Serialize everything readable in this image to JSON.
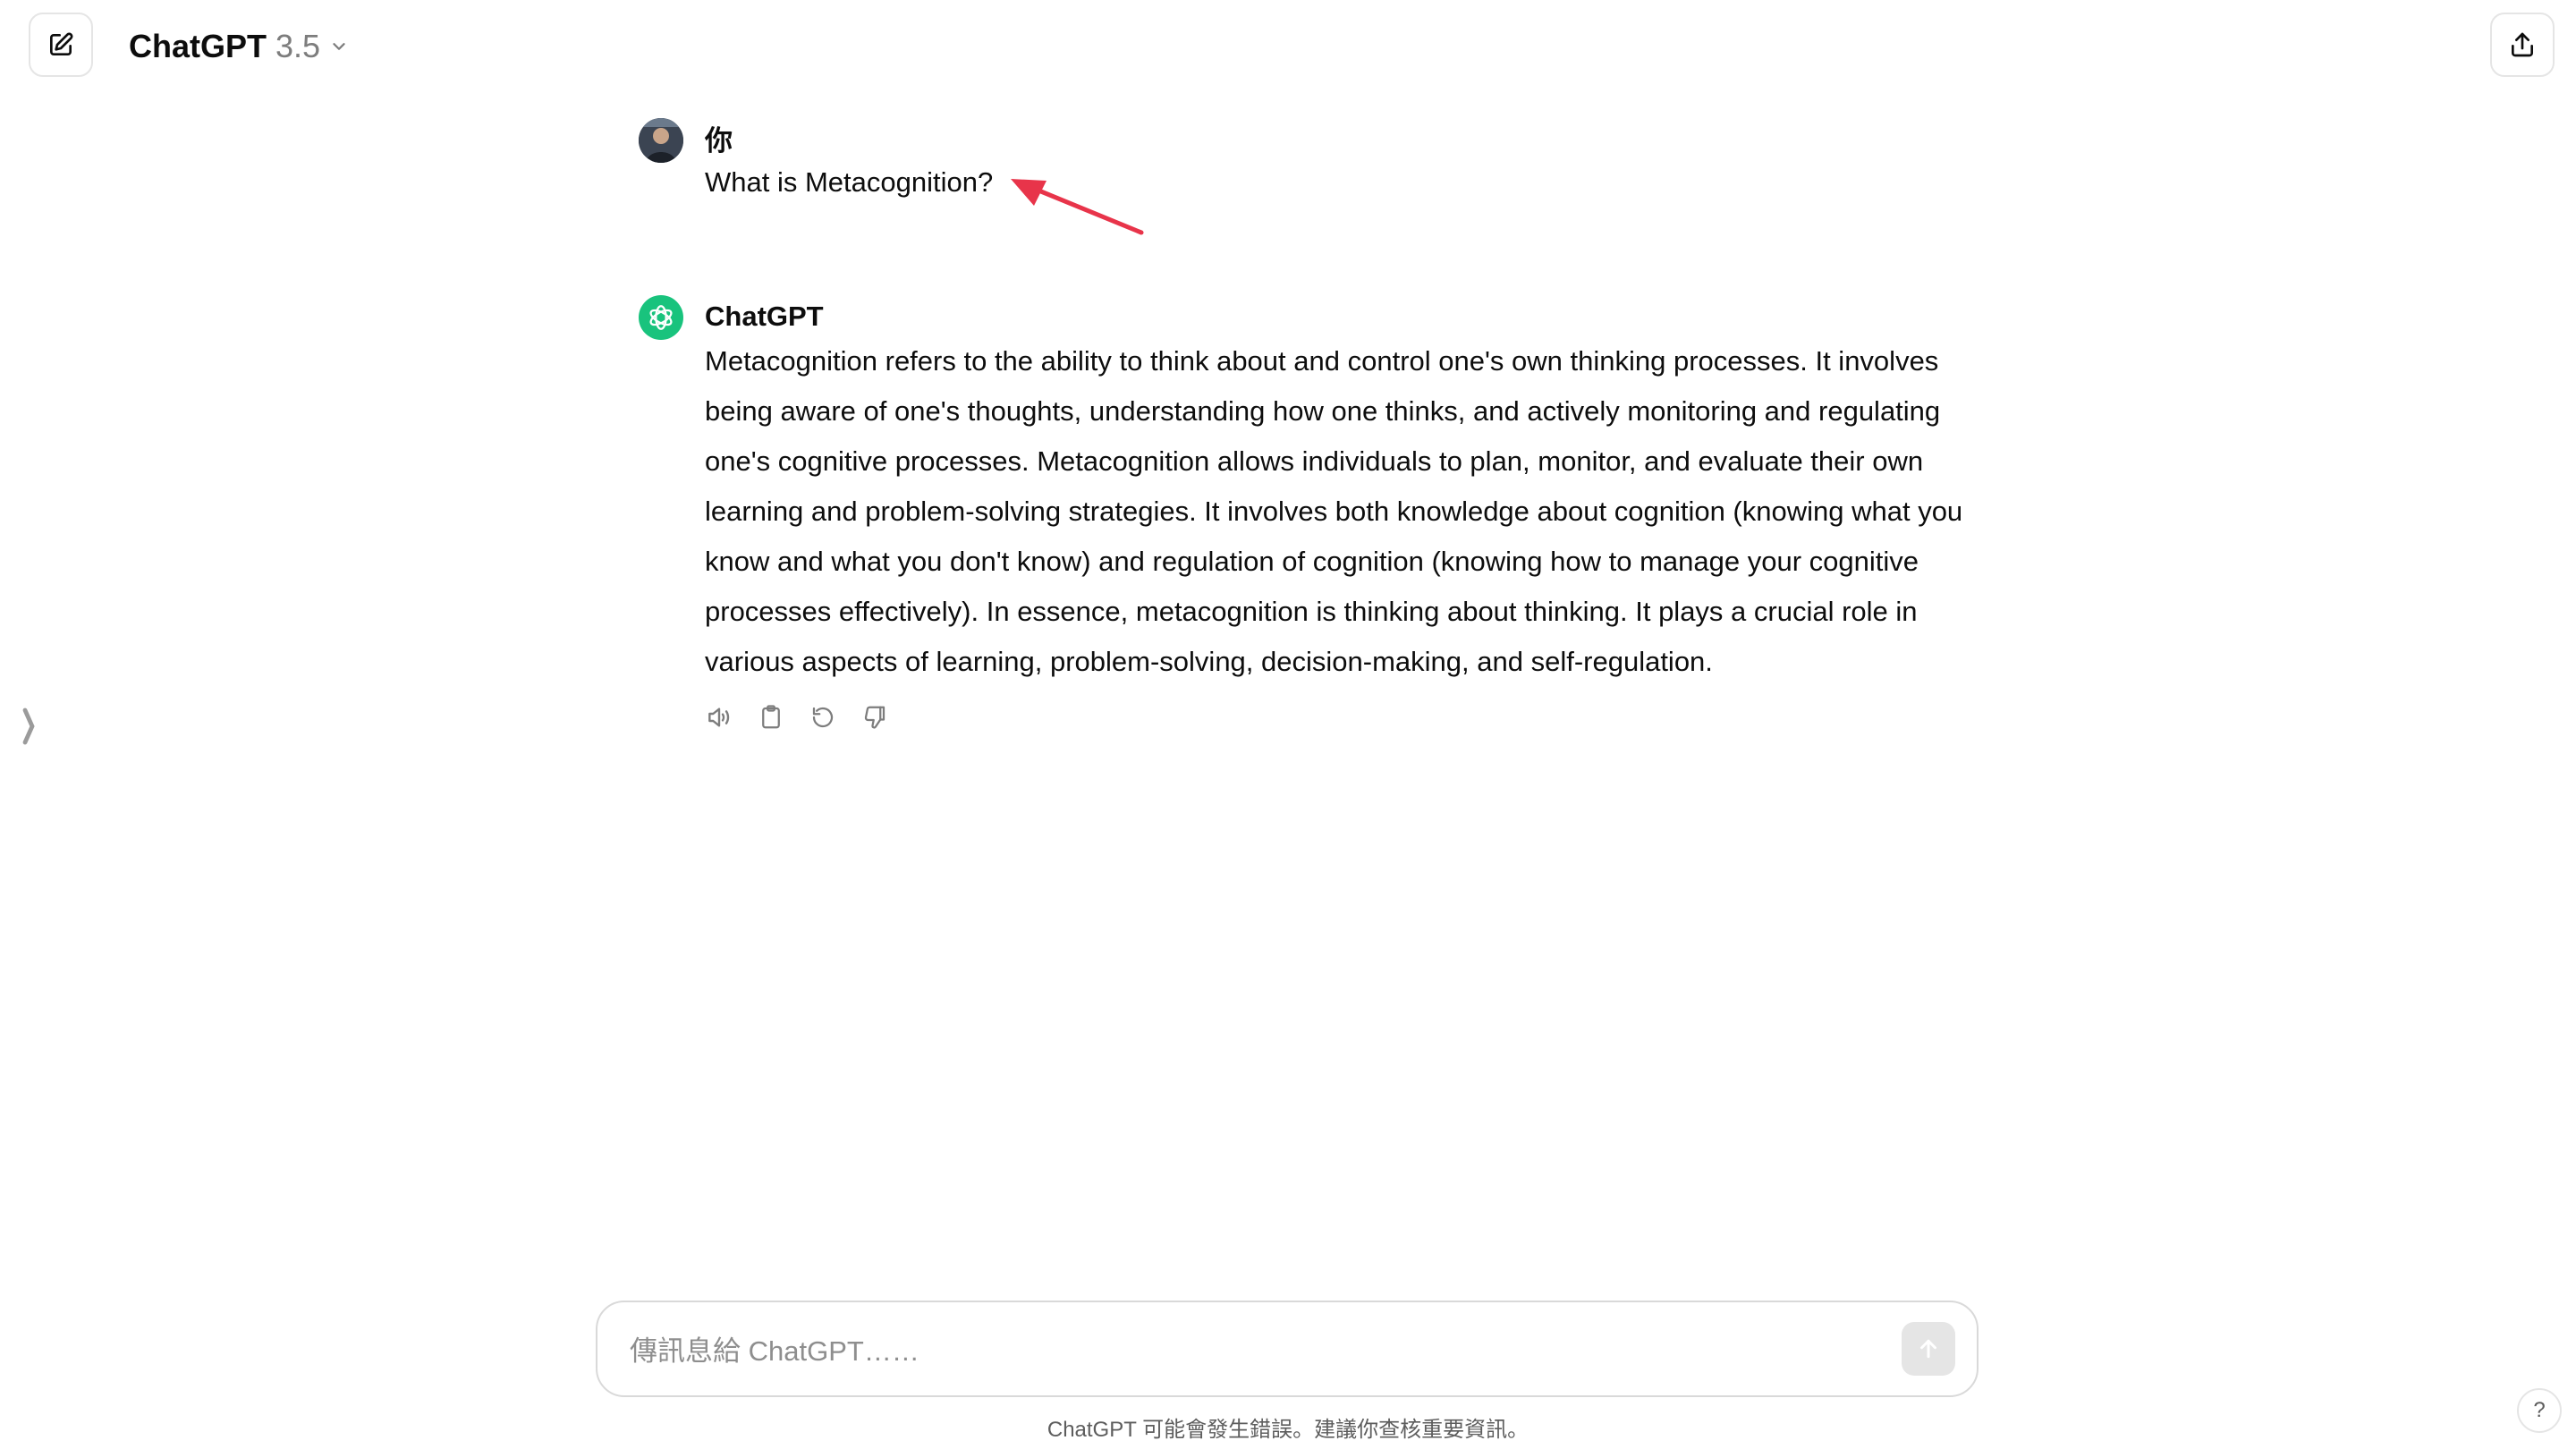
{
  "header": {
    "model_name": "ChatGPT",
    "model_version": "3.5",
    "new_chat_icon": "edit-icon",
    "share_icon": "share-icon",
    "dropdown_icon": "chevron-down-icon"
  },
  "conversation": {
    "user_message": {
      "author": "你",
      "text": "What is Metacognition?"
    },
    "assistant_message": {
      "author": "ChatGPT",
      "text": "Metacognition refers to the ability to think about and control one's own thinking processes. It involves being aware of one's thoughts, understanding how one thinks, and actively monitoring and regulating one's cognitive processes. Metacognition allows individuals to plan, monitor, and evaluate their own learning and problem-solving strategies. It involves both knowledge about cognition (knowing what you know and what you don't know) and regulation of cognition (knowing how to manage your cognitive processes effectively). In essence, metacognition is thinking about thinking. It plays a crucial role in various aspects of learning, problem-solving, decision-making, and self-regulation.",
      "actions": [
        "speaker-icon",
        "clipboard-icon",
        "regenerate-icon",
        "thumbs-down-icon"
      ]
    }
  },
  "composer": {
    "placeholder": "傳訊息給 ChatGPT……",
    "value": ""
  },
  "disclaimer": "ChatGPT 可能會發生錯誤。建議你查核重要資訊。",
  "help": {
    "label": "?"
  },
  "colors": {
    "accent_gpt": "#19c37d",
    "annotation_arrow": "#e8344a"
  }
}
